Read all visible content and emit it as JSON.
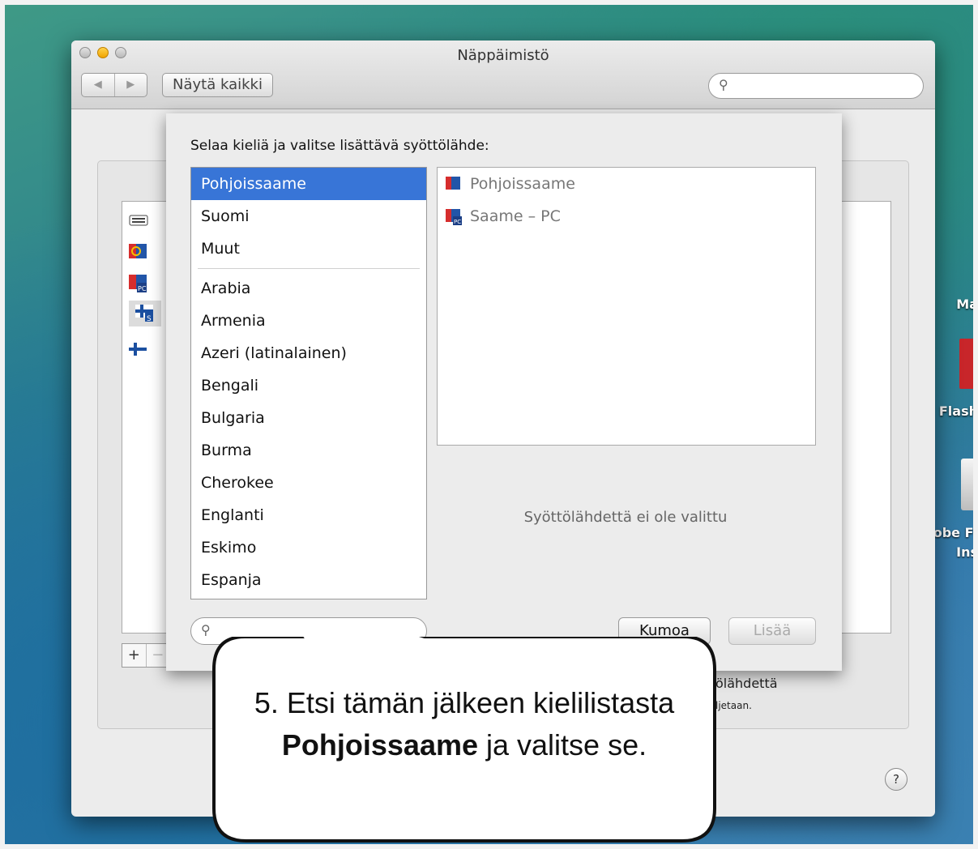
{
  "window": {
    "title": "Näppäimistö",
    "show_all": "Näytä kaikki",
    "nav_back": "◀",
    "nav_forward": "▶"
  },
  "sheet": {
    "prompt": "Selaa kieliä ja valitse lisättävä syöttölähde:",
    "languages_top": [
      "Pohjoissaame",
      "Suomi",
      "Muut"
    ],
    "languages": [
      "Arabia",
      "Armenia",
      "Azeri (latinalainen)",
      "Bengali",
      "Bulgaria",
      "Burma",
      "Cherokee",
      "Englanti",
      "Eskimo",
      "Espanja"
    ],
    "selected_language": "Pohjoissaame",
    "sources": [
      "Pohjoissaame",
      "Saame – PC"
    ],
    "no_selection": "Syöttölähdettä ei ole valittu",
    "cancel": "Kumoa",
    "add": "Lisää"
  },
  "background": {
    "text_line1": "ölähdettä",
    "text_line2": "ljetaan.",
    "plus": "+",
    "minus": "−",
    "help": "?"
  },
  "desktop": {
    "items": [
      "Ma",
      "Flash",
      "obe Fl",
      "Ins"
    ]
  },
  "callout": {
    "pre": "5. Etsi tämän jälkeen kielilistasta ",
    "bold": "Pohjoissaame",
    "post": " ja valitse se."
  },
  "colors": {
    "selection": "#3875d7",
    "sami_red": "#d62d2d",
    "sami_blue": "#2255a8"
  }
}
